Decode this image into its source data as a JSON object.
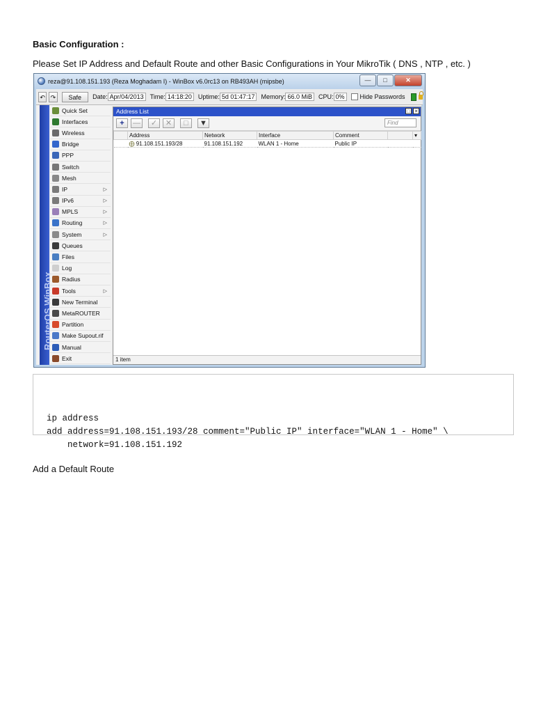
{
  "doc": {
    "heading": "Basic Configuration :",
    "intro": "Please Set IP Address and Default Route and other Basic Configurations in Your MikroTik ( DNS , NTP , etc. )",
    "after_code": "Add a Default Route"
  },
  "winbox": {
    "title": "reza@91.108.151.193 (Reza Moghadam I) - WinBox v6.0rc13 on RB493AH (mipsbe)",
    "toolbar": {
      "undo": "↶",
      "redo": "↷",
      "safe_mode": "Safe Mode",
      "date_label": "Date:",
      "date": "Apr/04/2013",
      "time_label": "Time:",
      "time": "14:18:20",
      "uptime_label": "Uptime:",
      "uptime": "5d 01:47:17",
      "memory_label": "Memory:",
      "memory": "66.0 MiB",
      "cpu_label": "CPU:",
      "cpu": "0%",
      "hide_passwords": "Hide Passwords"
    },
    "side_brand": "RouterOS WinBox",
    "menu": [
      {
        "label": "Quick Set",
        "color": "#6b8e3a",
        "arrow": ""
      },
      {
        "label": "Interfaces",
        "color": "#2f7a2f",
        "arrow": ""
      },
      {
        "label": "Wireless",
        "color": "#6a6a6a",
        "arrow": ""
      },
      {
        "label": "Bridge",
        "color": "#3366cc",
        "arrow": ""
      },
      {
        "label": "PPP",
        "color": "#3b67b8",
        "arrow": ""
      },
      {
        "label": "Switch",
        "color": "#777777",
        "arrow": ""
      },
      {
        "label": "Mesh",
        "color": "#888888",
        "arrow": ""
      },
      {
        "label": "IP",
        "color": "#7a7a7a",
        "arrow": "▷"
      },
      {
        "label": "IPv6",
        "color": "#7a7a7a",
        "arrow": "▷"
      },
      {
        "label": "MPLS",
        "color": "#9a7fb8",
        "arrow": "▷"
      },
      {
        "label": "Routing",
        "color": "#3a73c9",
        "arrow": "▷"
      },
      {
        "label": "System",
        "color": "#8a8a8a",
        "arrow": "▷"
      },
      {
        "label": "Queues",
        "color": "#3b3b3b",
        "arrow": ""
      },
      {
        "label": "Files",
        "color": "#4a7fc2",
        "arrow": ""
      },
      {
        "label": "Log",
        "color": "#cfcfcf",
        "arrow": ""
      },
      {
        "label": "Radius",
        "color": "#9c5a2c",
        "arrow": ""
      },
      {
        "label": "Tools",
        "color": "#c83a2a",
        "arrow": "▷"
      },
      {
        "label": "New Terminal",
        "color": "#3a3a3a",
        "arrow": ""
      },
      {
        "label": "MetaROUTER",
        "color": "#4a4a4a",
        "arrow": ""
      },
      {
        "label": "Partition",
        "color": "#d84b2b",
        "arrow": ""
      },
      {
        "label": "Make Supout.rif",
        "color": "#4a78c8",
        "arrow": ""
      },
      {
        "label": "Manual",
        "color": "#2d5db8",
        "arrow": ""
      },
      {
        "label": "Exit",
        "color": "#8a4a2a",
        "arrow": ""
      }
    ],
    "address_list": {
      "title": "Address List",
      "find_placeholder": "Find",
      "columns": [
        "Address",
        "Network",
        "Interface",
        "Comment"
      ],
      "rows": [
        {
          "address": "91.108.151.193/28",
          "network": "91.108.151.192",
          "interface": "WLAN 1 - Home",
          "comment": "Public IP"
        }
      ],
      "status": "1 item"
    }
  },
  "code": {
    "lines": [
      "ip address",
      "add address=91.108.151.193/28 comment=\"Public IP\" interface=\"WLAN 1 - Home\" \\",
      "    network=91.108.151.192"
    ]
  }
}
